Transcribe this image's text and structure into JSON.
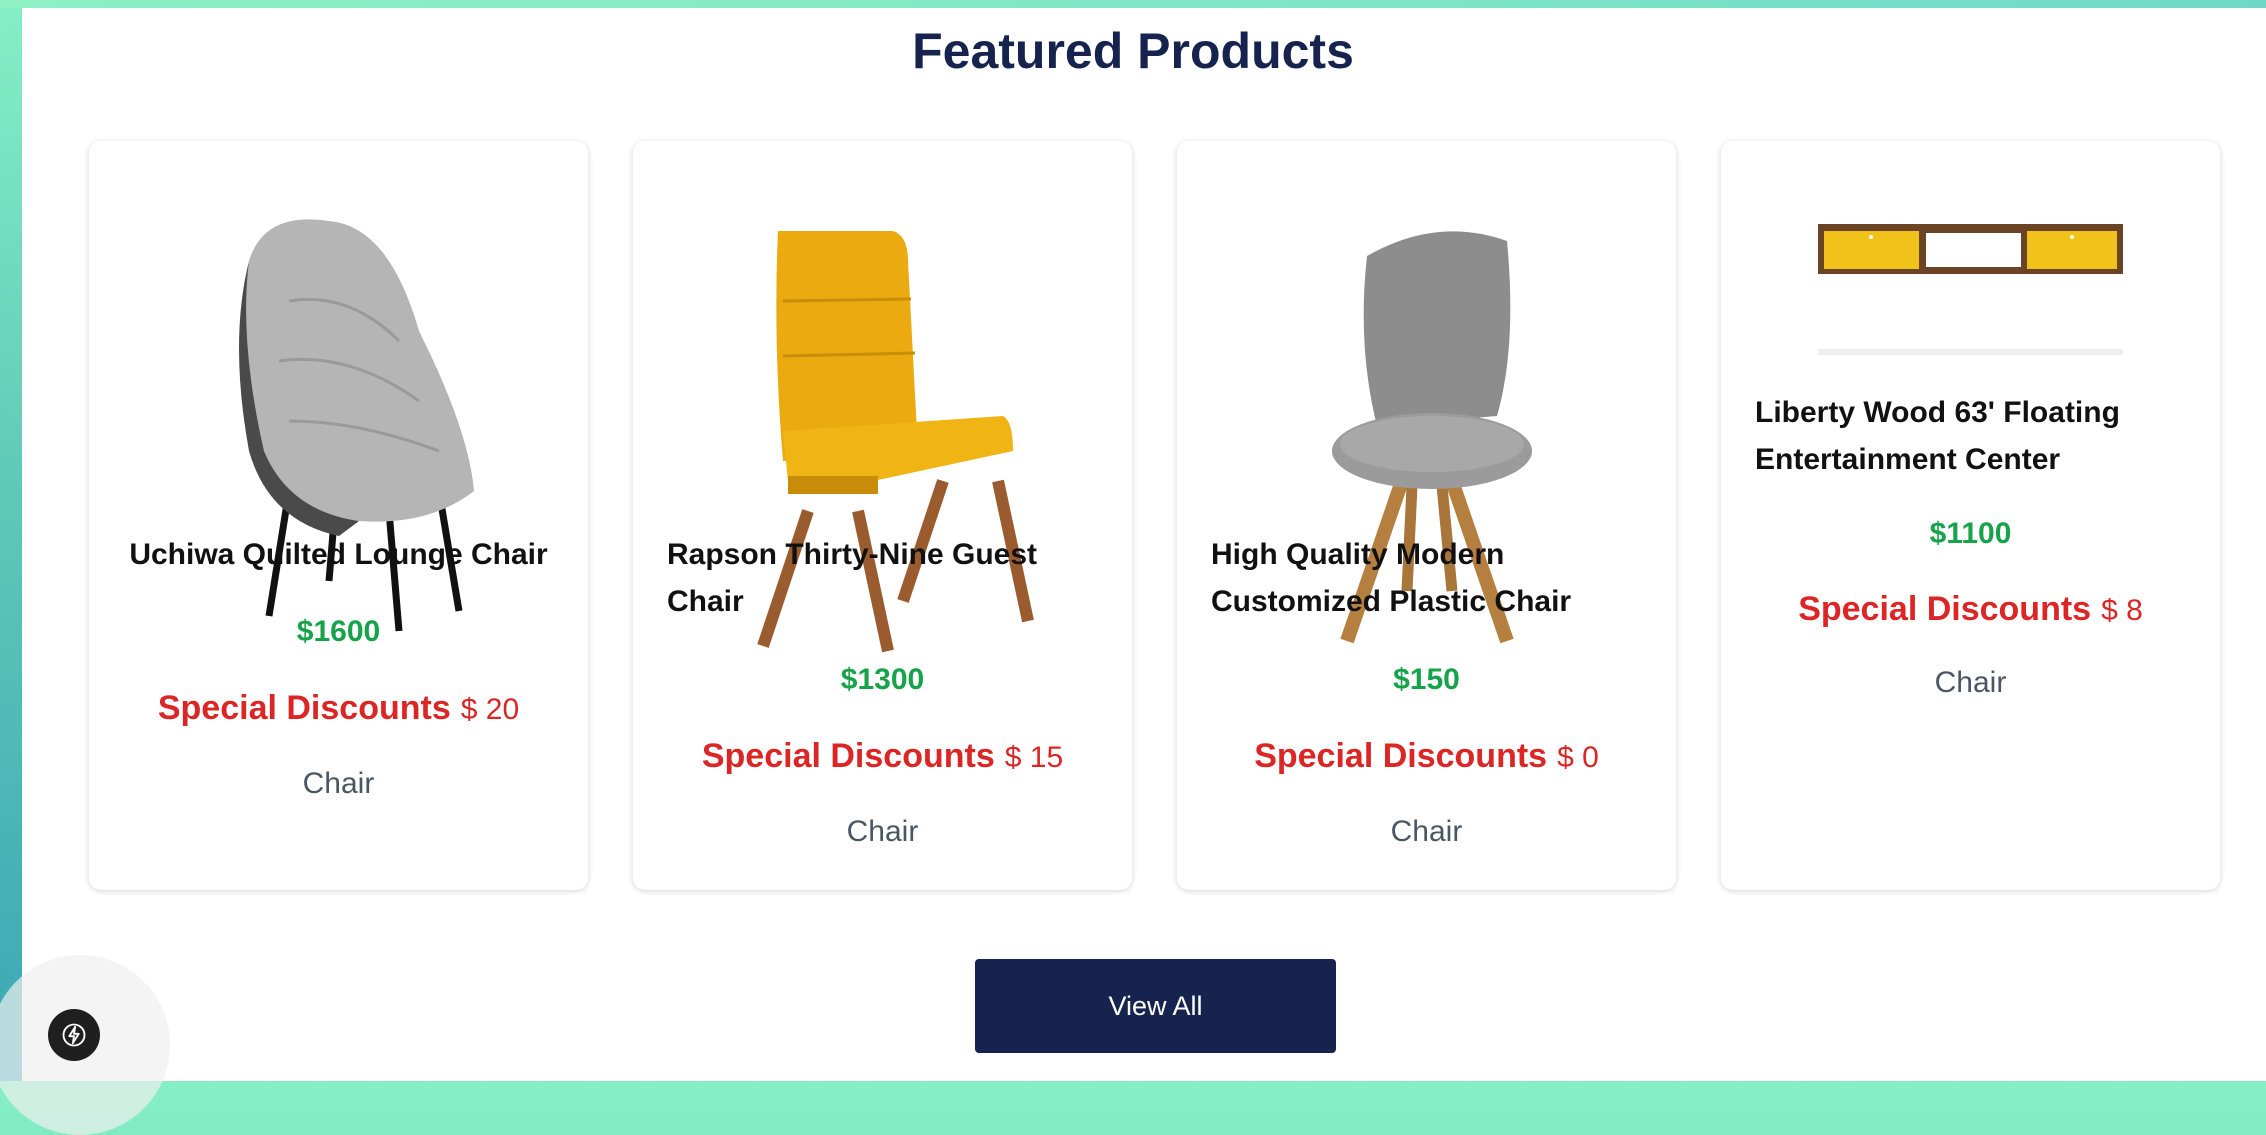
{
  "section": {
    "title": "Featured Products"
  },
  "products": [
    {
      "name": "Uchiwa Quilted Lounge Chair",
      "price": "$1600",
      "discount_label": "Special Discounts",
      "discount_amount": "$ 20",
      "category": "Chair",
      "image": "grey-lounge-chair"
    },
    {
      "name": "Rapson Thirty-Nine Guest Chair",
      "price": "$1300",
      "discount_label": "Special Discounts",
      "discount_amount": "$ 15",
      "category": "Chair",
      "image": "yellow-guest-chair"
    },
    {
      "name": "High Quality Modern Customized Plastic Chair",
      "price": "$150",
      "discount_label": "Special Discounts",
      "discount_amount": "$ 0",
      "category": "Chair",
      "image": "grey-plastic-chair"
    },
    {
      "name": "Liberty Wood 63' Floating Entertainment Center",
      "price": "$1100",
      "discount_label": "Special Discounts",
      "discount_amount": "$ 8",
      "category": "Chair",
      "image": "floating-entertainment-center"
    }
  ],
  "actions": {
    "view_all_label": "View All"
  },
  "fab": {
    "icon": "lightning-icon"
  },
  "colors": {
    "title": "#16234f",
    "price": "#17a34a",
    "discount": "#dc2626",
    "button": "#16234f"
  }
}
